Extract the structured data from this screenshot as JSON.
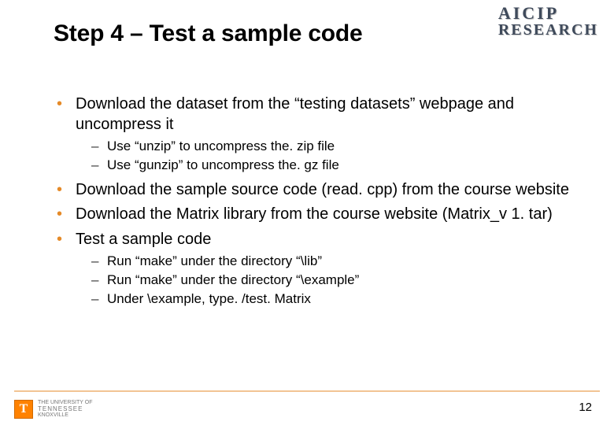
{
  "title": "Step 4 – Test a sample code",
  "logo_top": {
    "line1": "AICIP",
    "line2": "RESEARCH"
  },
  "bullets": [
    {
      "text": "Download the dataset from the “testing datasets” webpage and uncompress it",
      "sub": [
        "Use “unzip” to uncompress the. zip file",
        "Use “gunzip” to uncompress the. gz file"
      ]
    },
    {
      "text": "Download the sample source code (read. cpp) from the course website",
      "sub": []
    },
    {
      "text": "Download the Matrix library from the course website (Matrix_v 1. tar)",
      "sub": []
    },
    {
      "text": "Test a sample code",
      "sub": [
        "Run “make” under the directory “\\lib”",
        "Run “make” under the directory “\\example”",
        "Under \\example, type. /test. Matrix"
      ]
    }
  ],
  "footer": {
    "t": "T",
    "uni_small": "THE UNIVERSITY OF",
    "uni_big": "TENNESSEE",
    "uni_loc": "KNOXVILLE"
  },
  "page_number": "12"
}
